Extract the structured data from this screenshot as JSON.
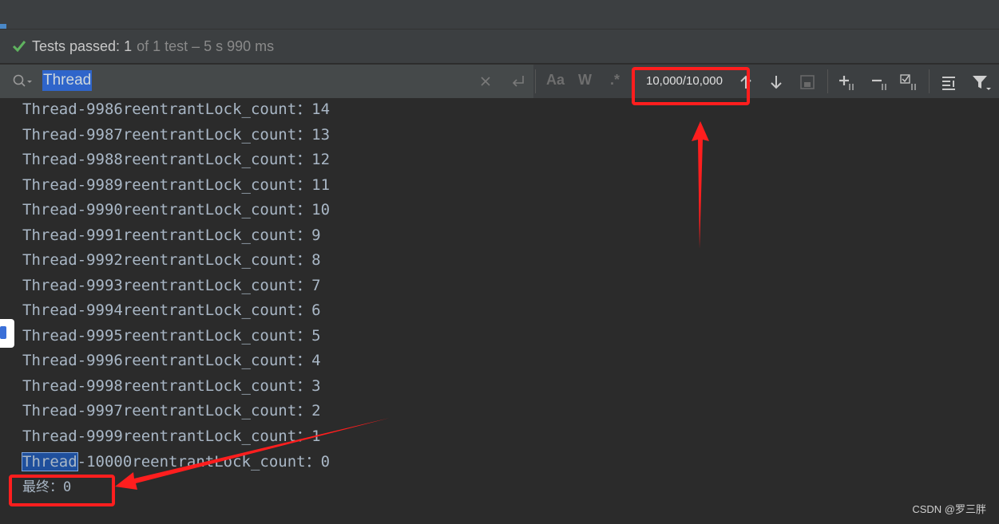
{
  "status": {
    "icon": "check-icon",
    "label": "Tests passed:",
    "count": "1",
    "detail": "of 1 test – 5 s 990 ms"
  },
  "search": {
    "query": "Thread",
    "toggles": {
      "match_case": "Aa",
      "words": "W",
      "regex": ".*"
    },
    "match_counter": "10,000/10,000",
    "icons": [
      "search-icon",
      "clear-icon",
      "newline-icon",
      "arrow-up-icon",
      "arrow-down-icon",
      "select-all-icon",
      "add-cursor-icon",
      "remove-cursor-icon",
      "select-occurrences-icon",
      "filter-lines-icon",
      "filter-icon"
    ]
  },
  "console": {
    "lines": [
      "Thread-9986reentrantLock_count：14",
      "Thread-9987reentrantLock_count：13",
      "Thread-9988reentrantLock_count：12",
      "Thread-9989reentrantLock_count：11",
      "Thread-9990reentrantLock_count：10",
      "Thread-9991reentrantLock_count：9",
      "Thread-9992reentrantLock_count：8",
      "Thread-9993reentrantLock_count：7",
      "Thread-9994reentrantLock_count：6",
      "Thread-9995reentrantLock_count：5",
      "Thread-9996reentrantLock_count：4",
      "Thread-9998reentrantLock_count：3",
      "Thread-9997reentrantLock_count：2",
      "Thread-9999reentrantLock_count：1"
    ],
    "last_line_highlight": "Thread",
    "last_line_rest": "-10000reentrantLock_count：0",
    "final_line": "最终：0"
  },
  "annotations": {
    "color": "#ff1e1e"
  },
  "watermark": "CSDN @罗三胖"
}
